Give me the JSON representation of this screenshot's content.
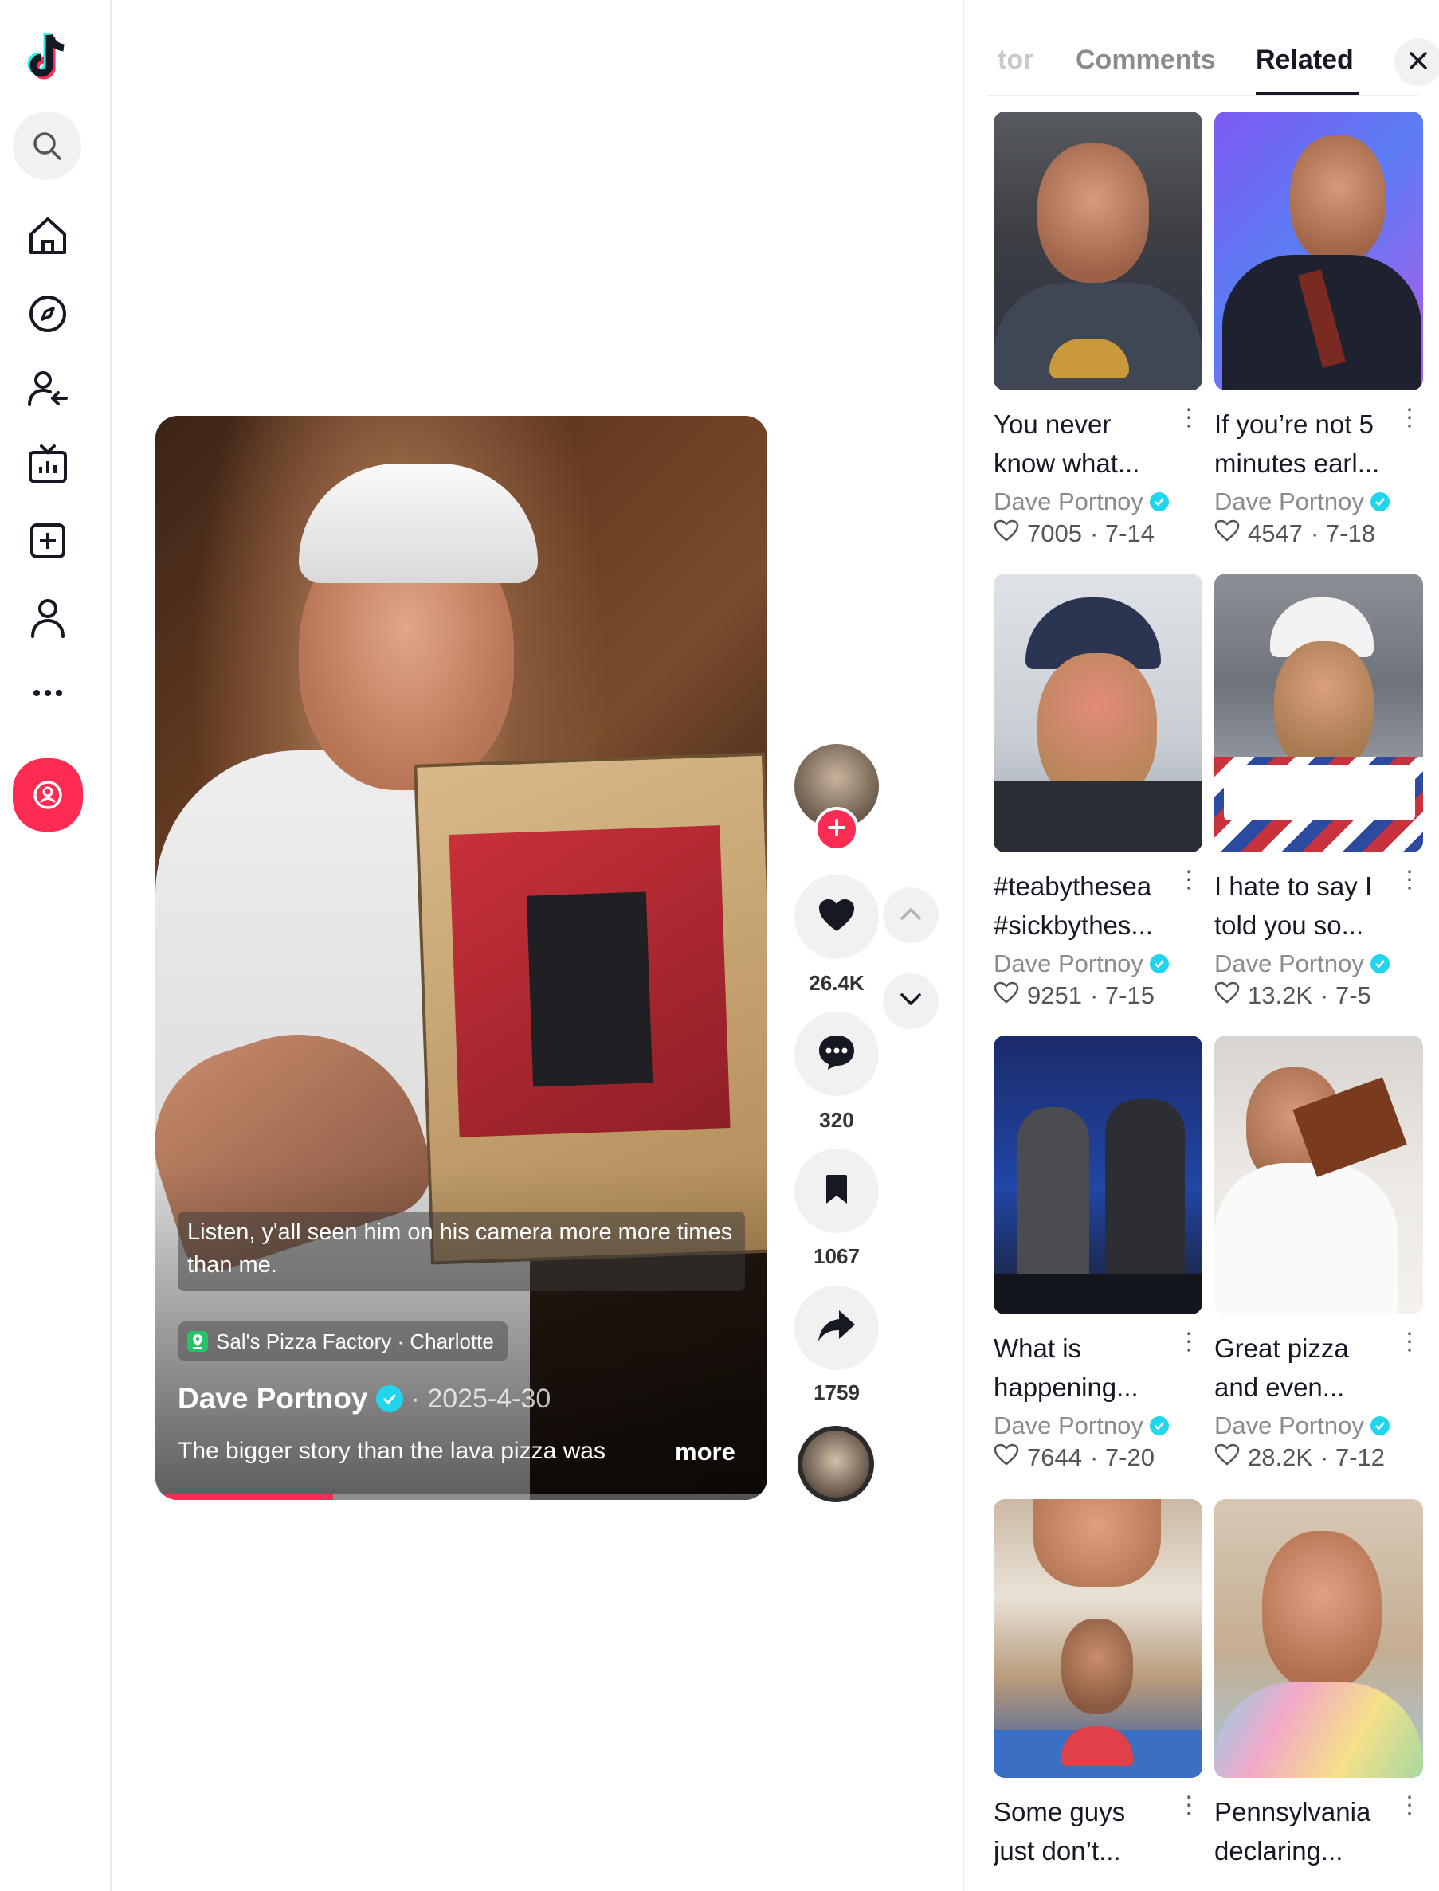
{
  "video": {
    "caption": "Listen, y'all seen him on his camera more more times than me.",
    "location": "Sal's Pizza Factory · Charlotte",
    "author": "Dave Portnoy",
    "date": "· 2025-4-30",
    "description": "The bigger story than the lava pizza was",
    "more_label": "more",
    "progress_fraction": 0.29
  },
  "actions": {
    "likes": "26.4K",
    "comments": "320",
    "saves": "1067",
    "shares": "1759"
  },
  "panel": {
    "tabs": [
      {
        "label": "tor"
      },
      {
        "label": "Comments"
      },
      {
        "label": "Related"
      }
    ],
    "active_tab": "Related",
    "cards": [
      {
        "title_1": "You never",
        "title_2": "know what...",
        "author": "Dave Portnoy",
        "likes": "7005",
        "date": "· 7-14"
      },
      {
        "title_1": "If you’re not 5",
        "title_2": "minutes earl...",
        "author": "Dave Portnoy",
        "likes": "4547",
        "date": "· 7-18"
      },
      {
        "title_1": "#teabythesea",
        "title_2": "#sickbythes...",
        "author": "Dave Portnoy",
        "likes": "9251",
        "date": "· 7-15"
      },
      {
        "title_1": "I hate to say I",
        "title_2": "told you so...",
        "author": "Dave Portnoy",
        "likes": "13.2K",
        "date": "· 7-5"
      },
      {
        "title_1": "What is",
        "title_2": "happening...",
        "author": "Dave Portnoy",
        "likes": "7644",
        "date": "· 7-20"
      },
      {
        "title_1": "Great pizza",
        "title_2": "and even...",
        "author": "Dave Portnoy",
        "likes": "28.2K",
        "date": "· 7-12"
      },
      {
        "title_1": "Some guys",
        "title_2": "just don’t...",
        "author": "",
        "likes": "",
        "date": ""
      },
      {
        "title_1": "Pennsylvania",
        "title_2": "declaring...",
        "author": "",
        "likes": "",
        "date": ""
      }
    ]
  },
  "colors": {
    "brand": "#fe2c55",
    "verified": "#20d5ec",
    "muted": "#8a8b91"
  }
}
